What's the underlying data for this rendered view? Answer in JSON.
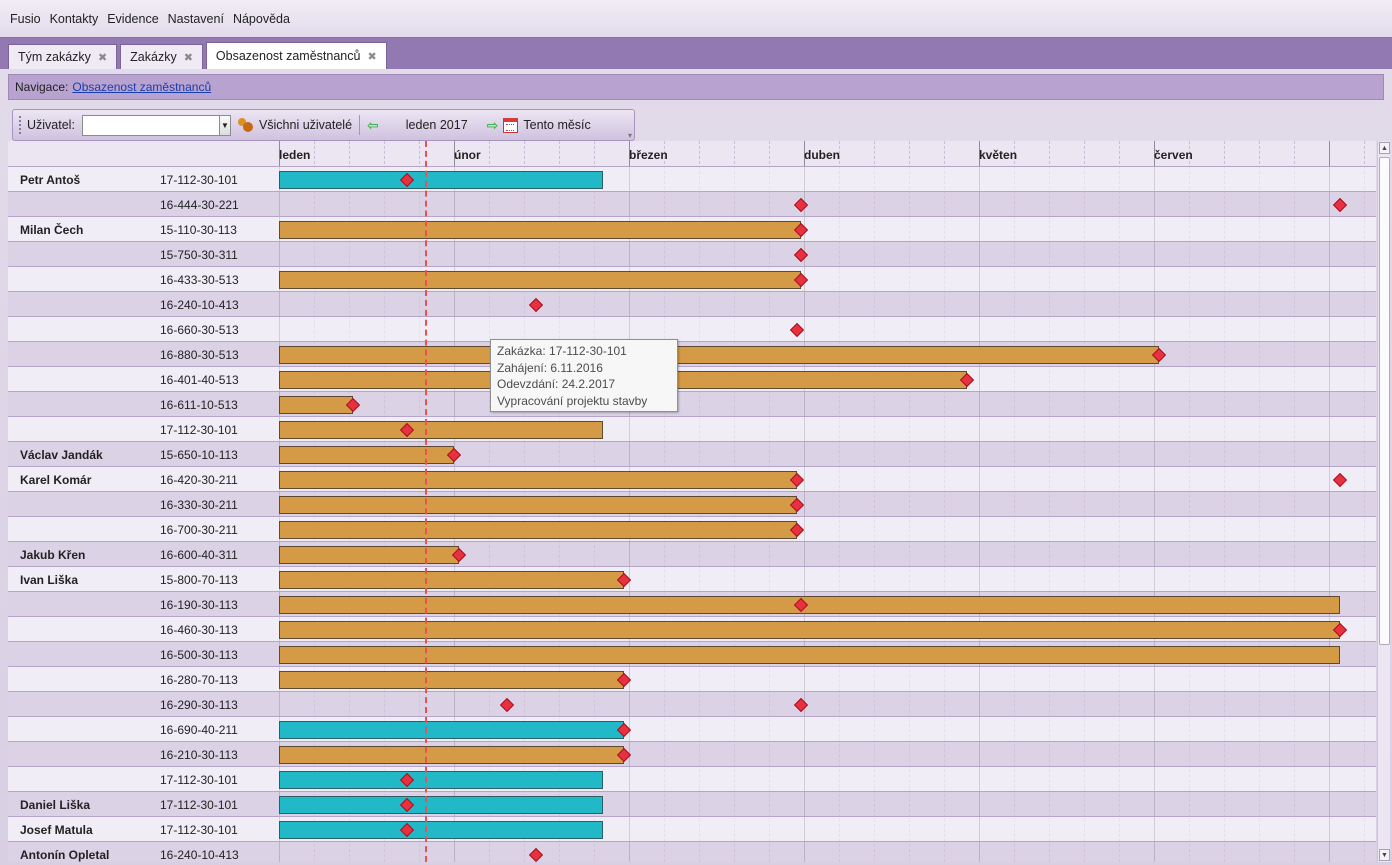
{
  "menu": [
    "Fusio",
    "Kontakty",
    "Evidence",
    "Nastavení",
    "Nápověda"
  ],
  "tabs": [
    {
      "label": "Tým zakázky",
      "active": false
    },
    {
      "label": "Zakázky",
      "active": false
    },
    {
      "label": "Obsazenost zaměstnanců",
      "active": true
    }
  ],
  "navigation": {
    "label": "Navigace:",
    "link": "Obsazenost zaměstnanců"
  },
  "toolbar": {
    "user_label": "Uživatel:",
    "user_value": "",
    "all_users": "Všichni uživatelé",
    "month": "leden 2017",
    "this_month": "Tento měsíc",
    "icons": [
      "users-icon",
      "arrow-left-icon",
      "arrow-right-icon",
      "calendar-icon"
    ]
  },
  "colors": {
    "bar_orange": "#d49a45",
    "bar_cyan": "#21b8c7",
    "milestone": "#e8313e",
    "today_line": "#e9524f"
  },
  "timeline": {
    "months": [
      "leden",
      "únor",
      "březen",
      "duben",
      "květen",
      "červen"
    ]
  },
  "rows": [
    {
      "name": "Petr Antoš",
      "code": "17-112-30-101",
      "bar": {
        "from": 0,
        "to": 1.85,
        "color": "cyan"
      },
      "milestones": [
        0.73
      ]
    },
    {
      "name": "",
      "code": "16-444-30-221",
      "bar": null,
      "milestones": [
        2.98,
        6.06
      ]
    },
    {
      "name": "Milan Čech",
      "code": "15-110-30-113",
      "bar": {
        "from": 0,
        "to": 2.98,
        "color": "orange"
      },
      "milestones": [
        2.98
      ]
    },
    {
      "name": "",
      "code": "15-750-30-311",
      "bar": null,
      "milestones": [
        2.98
      ]
    },
    {
      "name": "",
      "code": "16-433-30-513",
      "bar": {
        "from": 0,
        "to": 2.98,
        "color": "orange"
      },
      "milestones": [
        2.98
      ]
    },
    {
      "name": "",
      "code": "16-240-10-413",
      "bar": null,
      "milestones": [
        1.47
      ]
    },
    {
      "name": "",
      "code": "16-660-30-513",
      "bar": null,
      "milestones": [
        2.96
      ]
    },
    {
      "name": "",
      "code": "16-880-30-513",
      "bar": {
        "from": 0,
        "to": 5.03,
        "color": "orange"
      },
      "milestones": [
        5.03
      ]
    },
    {
      "name": "",
      "code": "16-401-40-513",
      "bar": {
        "from": 0,
        "to": 3.93,
        "color": "orange"
      },
      "milestones": [
        3.93
      ]
    },
    {
      "name": "",
      "code": "16-611-10-513",
      "bar": {
        "from": 0,
        "to": 0.42,
        "color": "orange"
      },
      "milestones": [
        0.42
      ]
    },
    {
      "name": "",
      "code": "17-112-30-101",
      "bar": {
        "from": 0,
        "to": 1.85,
        "color": "orange"
      },
      "milestones": [
        0.73
      ]
    },
    {
      "name": "Václav Jandák",
      "code": "15-650-10-113",
      "bar": {
        "from": 0,
        "to": 1.0,
        "color": "orange"
      },
      "milestones": [
        1.0
      ]
    },
    {
      "name": "Karel Komár",
      "code": "16-420-30-211",
      "bar": {
        "from": 0,
        "to": 2.96,
        "color": "orange"
      },
      "milestones": [
        2.96,
        6.06
      ]
    },
    {
      "name": "",
      "code": "16-330-30-211",
      "bar": {
        "from": 0,
        "to": 2.96,
        "color": "orange"
      },
      "milestones": [
        2.96
      ]
    },
    {
      "name": "",
      "code": "16-700-30-211",
      "bar": {
        "from": 0,
        "to": 2.96,
        "color": "orange"
      },
      "milestones": [
        2.96
      ]
    },
    {
      "name": "Jakub Křen",
      "code": "16-600-40-311",
      "bar": {
        "from": 0,
        "to": 1.03,
        "color": "orange"
      },
      "milestones": [
        1.03
      ]
    },
    {
      "name": "Ivan Liška",
      "code": "15-800-70-113",
      "bar": {
        "from": 0,
        "to": 1.97,
        "color": "orange"
      },
      "milestones": [
        1.97
      ]
    },
    {
      "name": "",
      "code": "16-190-30-113",
      "bar": {
        "from": 0,
        "to": 6.06,
        "color": "orange"
      },
      "milestones": [
        2.98
      ]
    },
    {
      "name": "",
      "code": "16-460-30-113",
      "bar": {
        "from": 0,
        "to": 6.06,
        "color": "orange"
      },
      "milestones": [
        6.06
      ]
    },
    {
      "name": "",
      "code": "16-500-30-113",
      "bar": {
        "from": 0,
        "to": 6.06,
        "color": "orange"
      },
      "milestones": []
    },
    {
      "name": "",
      "code": "16-280-70-113",
      "bar": {
        "from": 0,
        "to": 1.97,
        "color": "orange"
      },
      "milestones": [
        1.97
      ]
    },
    {
      "name": "",
      "code": "16-290-30-113",
      "bar": null,
      "milestones": [
        1.3,
        2.98
      ]
    },
    {
      "name": "",
      "code": "16-690-40-211",
      "bar": {
        "from": 0,
        "to": 1.97,
        "color": "cyan"
      },
      "milestones": [
        1.97
      ]
    },
    {
      "name": "",
      "code": "16-210-30-113",
      "bar": {
        "from": 0,
        "to": 1.97,
        "color": "orange"
      },
      "milestones": [
        1.97
      ]
    },
    {
      "name": "",
      "code": "17-112-30-101",
      "bar": {
        "from": 0,
        "to": 1.85,
        "color": "cyan"
      },
      "milestones": [
        0.73
      ]
    },
    {
      "name": "Daniel Liška",
      "code": "17-112-30-101",
      "bar": {
        "from": 0,
        "to": 1.85,
        "color": "cyan"
      },
      "milestones": [
        0.73
      ]
    },
    {
      "name": "Josef Matula",
      "code": "17-112-30-101",
      "bar": {
        "from": 0,
        "to": 1.85,
        "color": "cyan"
      },
      "milestones": [
        0.73
      ]
    },
    {
      "name": "Antonín Opletal",
      "code": "16-240-10-413",
      "bar": null,
      "milestones": [
        1.47
      ]
    }
  ],
  "tooltip": [
    "Zakázka: 17-112-30-101",
    "Zahájení: 6.11.2016",
    "Odevzdání: 24.2.2017",
    "Vypracování projektu stavby"
  ]
}
